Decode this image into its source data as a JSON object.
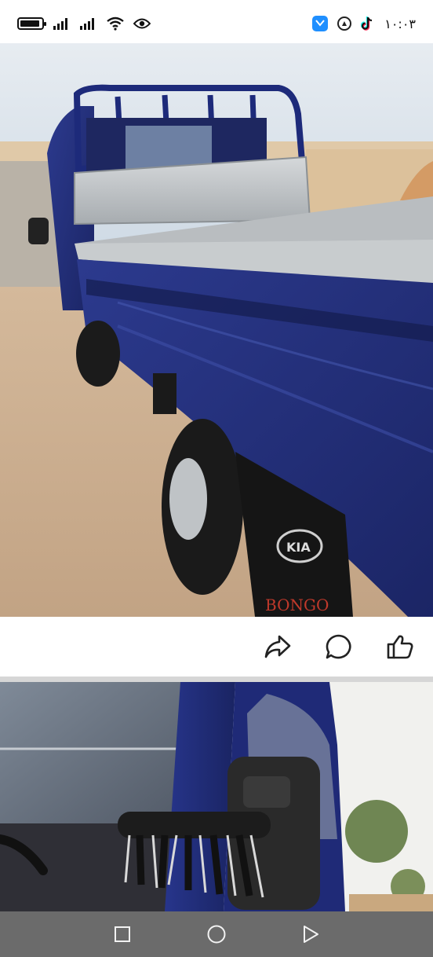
{
  "status_bar": {
    "time": "١٠:٠٣",
    "icons": [
      "battery-icon",
      "signal-icon",
      "signal-icon",
      "wifi-icon",
      "eye-icon",
      "app-icon",
      "circle-app-icon",
      "tiktok-icon"
    ]
  },
  "post": {
    "photo_1": {
      "subject": "blue-pickup-truck-side",
      "logo_text_1": "KIA",
      "logo_text_2": "BONGO"
    },
    "actions": [
      "share-icon",
      "comment-icon",
      "like-icon"
    ],
    "photo_2": {
      "subject": "truck-cab-mirror"
    }
  },
  "navigation": {
    "buttons": [
      "recent-apps-icon",
      "home-icon",
      "back-icon"
    ]
  },
  "colors": {
    "truck_blue": "#23307a",
    "nav_bar": "#6b6b6b",
    "divider": "#d6d6d6"
  }
}
